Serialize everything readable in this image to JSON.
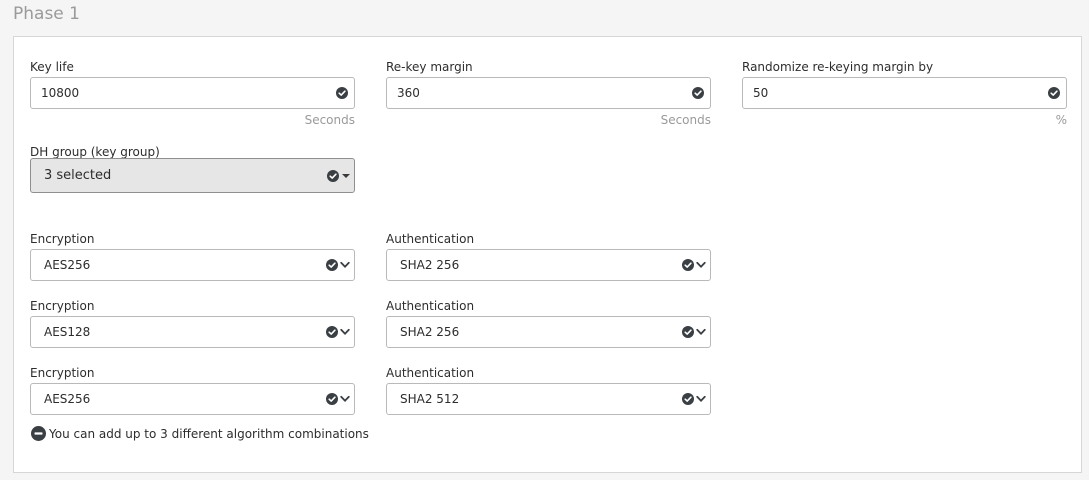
{
  "phase": {
    "title": "Phase 1"
  },
  "fields": {
    "key_life": {
      "label": "Key life",
      "value": "10800",
      "unit": "Seconds"
    },
    "rekey_margin": {
      "label": "Re-key margin",
      "value": "360",
      "unit": "Seconds"
    },
    "randomize": {
      "label": "Randomize re-keying margin by",
      "value": "50",
      "unit": "%"
    },
    "dh_group": {
      "label": "DH group (key group)",
      "value": "3 selected"
    }
  },
  "combos": [
    {
      "enc_label": "Encryption",
      "enc_value": "AES256",
      "auth_label": "Authentication",
      "auth_value": "SHA2 256"
    },
    {
      "enc_label": "Encryption",
      "enc_value": "AES128",
      "auth_label": "Authentication",
      "auth_value": "SHA2 256"
    },
    {
      "enc_label": "Encryption",
      "enc_value": "AES256",
      "auth_label": "Authentication",
      "auth_value": "SHA2 512"
    }
  ],
  "hint": {
    "text": "You can add up to 3 different algorithm combinations"
  },
  "icons": {
    "valid": "check-circle-icon",
    "dropdown": "chevron-down-icon",
    "caret": "caret-down-icon",
    "remove": "minus-circle-icon"
  },
  "colors": {
    "icon": "#3a3f44",
    "muted_text": "#9a9a9a",
    "border": "#b9b9b9"
  }
}
